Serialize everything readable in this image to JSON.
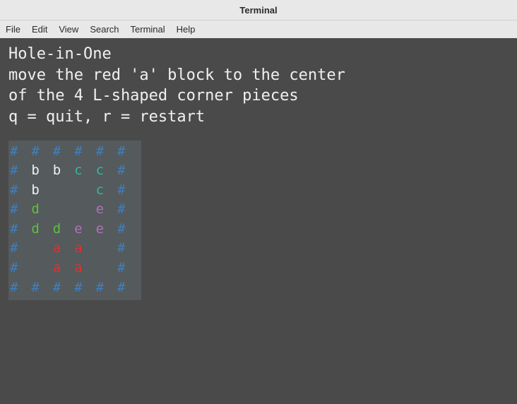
{
  "window": {
    "title": "Terminal"
  },
  "menu": {
    "file": "File",
    "edit": "Edit",
    "view": "View",
    "search": "Search",
    "terminal": "Terminal",
    "help": "Help"
  },
  "game": {
    "title": "Hole-in-One",
    "line1": "move the red 'a' block to the center",
    "line2": "of the 4 L-shaped corner pieces",
    "controls": "q = quit,  r = restart"
  },
  "colors": {
    "wall": "#3f7fbf",
    "b": "#f0f0f0",
    "c": "#2fb8a0",
    "d": "#5fbf3f",
    "e": "#b070c0",
    "a": "#e03030"
  },
  "board": {
    "legend": {
      "#": "wall",
      "b": "b",
      "c": "c",
      "d": "d",
      "e": "e",
      "a": "a",
      ".": "empty"
    },
    "rows": [
      [
        "#",
        "#",
        "#",
        "#",
        "#",
        "#"
      ],
      [
        "#",
        "b",
        "b",
        "c",
        "c",
        "#"
      ],
      [
        "#",
        "b",
        ".",
        ".",
        "c",
        "#"
      ],
      [
        "#",
        "d",
        ".",
        ".",
        "e",
        "#"
      ],
      [
        "#",
        "d",
        "d",
        "e",
        "e",
        "#"
      ],
      [
        "#",
        ".",
        "a",
        "a",
        ".",
        "#"
      ],
      [
        "#",
        ".",
        "a",
        "a",
        ".",
        "#"
      ],
      [
        "#",
        "#",
        "#",
        "#",
        "#",
        "#"
      ]
    ]
  }
}
